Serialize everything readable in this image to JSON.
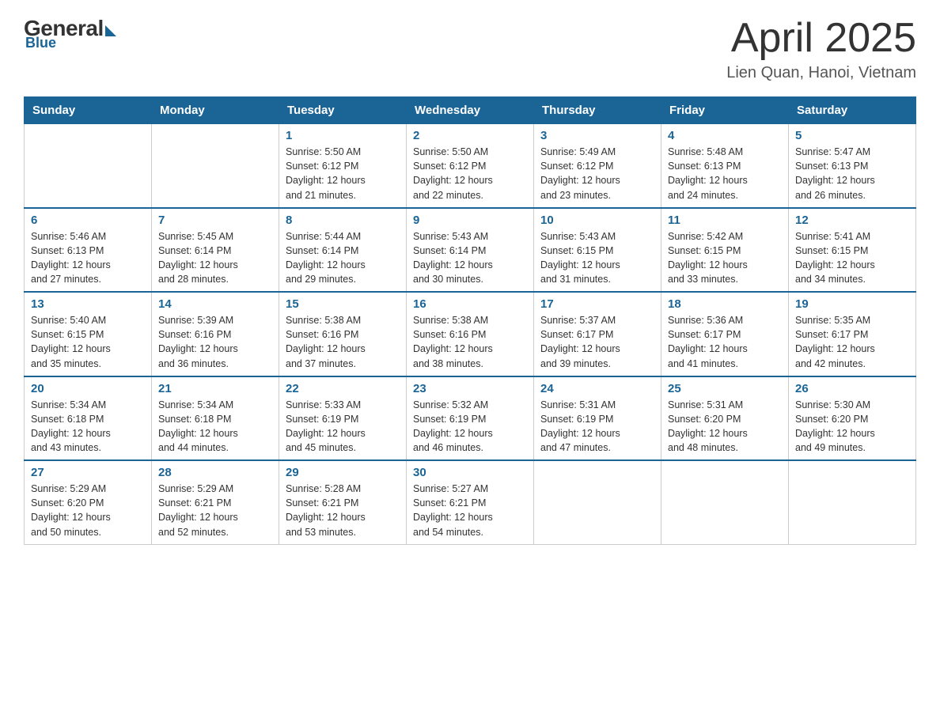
{
  "logo": {
    "general": "General",
    "blue": "Blue"
  },
  "header": {
    "month_year": "April 2025",
    "location": "Lien Quan, Hanoi, Vietnam"
  },
  "days_of_week": [
    "Sunday",
    "Monday",
    "Tuesday",
    "Wednesday",
    "Thursday",
    "Friday",
    "Saturday"
  ],
  "weeks": [
    [
      {
        "day": "",
        "info": ""
      },
      {
        "day": "",
        "info": ""
      },
      {
        "day": "1",
        "info": "Sunrise: 5:50 AM\nSunset: 6:12 PM\nDaylight: 12 hours\nand 21 minutes."
      },
      {
        "day": "2",
        "info": "Sunrise: 5:50 AM\nSunset: 6:12 PM\nDaylight: 12 hours\nand 22 minutes."
      },
      {
        "day": "3",
        "info": "Sunrise: 5:49 AM\nSunset: 6:12 PM\nDaylight: 12 hours\nand 23 minutes."
      },
      {
        "day": "4",
        "info": "Sunrise: 5:48 AM\nSunset: 6:13 PM\nDaylight: 12 hours\nand 24 minutes."
      },
      {
        "day": "5",
        "info": "Sunrise: 5:47 AM\nSunset: 6:13 PM\nDaylight: 12 hours\nand 26 minutes."
      }
    ],
    [
      {
        "day": "6",
        "info": "Sunrise: 5:46 AM\nSunset: 6:13 PM\nDaylight: 12 hours\nand 27 minutes."
      },
      {
        "day": "7",
        "info": "Sunrise: 5:45 AM\nSunset: 6:14 PM\nDaylight: 12 hours\nand 28 minutes."
      },
      {
        "day": "8",
        "info": "Sunrise: 5:44 AM\nSunset: 6:14 PM\nDaylight: 12 hours\nand 29 minutes."
      },
      {
        "day": "9",
        "info": "Sunrise: 5:43 AM\nSunset: 6:14 PM\nDaylight: 12 hours\nand 30 minutes."
      },
      {
        "day": "10",
        "info": "Sunrise: 5:43 AM\nSunset: 6:15 PM\nDaylight: 12 hours\nand 31 minutes."
      },
      {
        "day": "11",
        "info": "Sunrise: 5:42 AM\nSunset: 6:15 PM\nDaylight: 12 hours\nand 33 minutes."
      },
      {
        "day": "12",
        "info": "Sunrise: 5:41 AM\nSunset: 6:15 PM\nDaylight: 12 hours\nand 34 minutes."
      }
    ],
    [
      {
        "day": "13",
        "info": "Sunrise: 5:40 AM\nSunset: 6:15 PM\nDaylight: 12 hours\nand 35 minutes."
      },
      {
        "day": "14",
        "info": "Sunrise: 5:39 AM\nSunset: 6:16 PM\nDaylight: 12 hours\nand 36 minutes."
      },
      {
        "day": "15",
        "info": "Sunrise: 5:38 AM\nSunset: 6:16 PM\nDaylight: 12 hours\nand 37 minutes."
      },
      {
        "day": "16",
        "info": "Sunrise: 5:38 AM\nSunset: 6:16 PM\nDaylight: 12 hours\nand 38 minutes."
      },
      {
        "day": "17",
        "info": "Sunrise: 5:37 AM\nSunset: 6:17 PM\nDaylight: 12 hours\nand 39 minutes."
      },
      {
        "day": "18",
        "info": "Sunrise: 5:36 AM\nSunset: 6:17 PM\nDaylight: 12 hours\nand 41 minutes."
      },
      {
        "day": "19",
        "info": "Sunrise: 5:35 AM\nSunset: 6:17 PM\nDaylight: 12 hours\nand 42 minutes."
      }
    ],
    [
      {
        "day": "20",
        "info": "Sunrise: 5:34 AM\nSunset: 6:18 PM\nDaylight: 12 hours\nand 43 minutes."
      },
      {
        "day": "21",
        "info": "Sunrise: 5:34 AM\nSunset: 6:18 PM\nDaylight: 12 hours\nand 44 minutes."
      },
      {
        "day": "22",
        "info": "Sunrise: 5:33 AM\nSunset: 6:19 PM\nDaylight: 12 hours\nand 45 minutes."
      },
      {
        "day": "23",
        "info": "Sunrise: 5:32 AM\nSunset: 6:19 PM\nDaylight: 12 hours\nand 46 minutes."
      },
      {
        "day": "24",
        "info": "Sunrise: 5:31 AM\nSunset: 6:19 PM\nDaylight: 12 hours\nand 47 minutes."
      },
      {
        "day": "25",
        "info": "Sunrise: 5:31 AM\nSunset: 6:20 PM\nDaylight: 12 hours\nand 48 minutes."
      },
      {
        "day": "26",
        "info": "Sunrise: 5:30 AM\nSunset: 6:20 PM\nDaylight: 12 hours\nand 49 minutes."
      }
    ],
    [
      {
        "day": "27",
        "info": "Sunrise: 5:29 AM\nSunset: 6:20 PM\nDaylight: 12 hours\nand 50 minutes."
      },
      {
        "day": "28",
        "info": "Sunrise: 5:29 AM\nSunset: 6:21 PM\nDaylight: 12 hours\nand 52 minutes."
      },
      {
        "day": "29",
        "info": "Sunrise: 5:28 AM\nSunset: 6:21 PM\nDaylight: 12 hours\nand 53 minutes."
      },
      {
        "day": "30",
        "info": "Sunrise: 5:27 AM\nSunset: 6:21 PM\nDaylight: 12 hours\nand 54 minutes."
      },
      {
        "day": "",
        "info": ""
      },
      {
        "day": "",
        "info": ""
      },
      {
        "day": "",
        "info": ""
      }
    ]
  ]
}
